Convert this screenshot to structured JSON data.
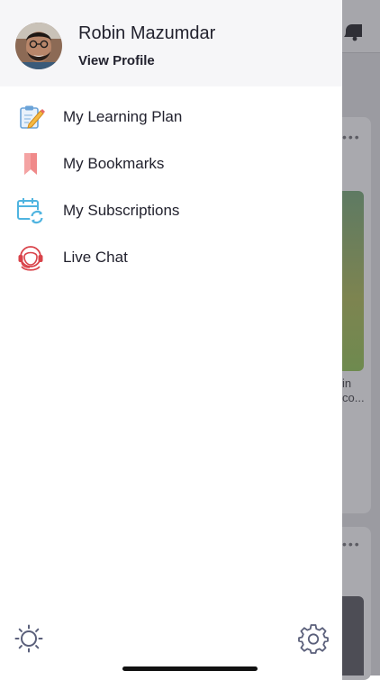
{
  "profile": {
    "name": "Robin Mazumdar",
    "link_label": "View Profile",
    "avatar_icon": "user-avatar"
  },
  "menu": {
    "items": [
      {
        "label": "My Learning Plan",
        "icon": "notepad-pencil-icon"
      },
      {
        "label": "My Bookmarks",
        "icon": "bookmark-icon"
      },
      {
        "label": "My Subscriptions",
        "icon": "calendar-refresh-icon"
      },
      {
        "label": "Live Chat",
        "icon": "headset-agent-icon"
      }
    ]
  },
  "footer": {
    "theme_icon": "sun-icon",
    "settings_icon": "gear-icon"
  },
  "background": {
    "partial_text_line1": "in",
    "partial_text_line2": "co..."
  },
  "colors": {
    "drawer_bg": "#ffffff",
    "profile_bg": "#f6f6f8",
    "text": "#22222e",
    "bookmark": "#f08a8a",
    "subscriptions": "#4fb4e0",
    "live_chat": "#d9434a",
    "footer_icons": "#5a5f7a"
  }
}
